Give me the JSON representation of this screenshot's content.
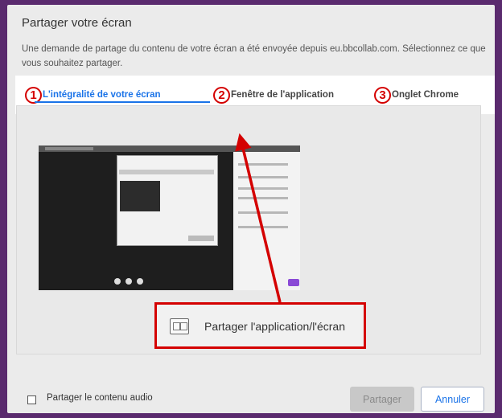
{
  "dialog": {
    "title": "Partager votre écran",
    "description": "Une demande de partage du contenu de votre écran a été envoyée depuis eu.bbcollab.com. Sélectionnez ce que vous souhaitez partager."
  },
  "tabs": [
    {
      "number": "1",
      "label": "L'intégralité de votre écran",
      "active": true
    },
    {
      "number": "2",
      "label": "Fenêtre de l'application",
      "active": false
    },
    {
      "number": "3",
      "label": "Onglet Chrome",
      "active": false
    }
  ],
  "callout": {
    "label": "Partager l'application/l'écran",
    "icon": "window-share-icon"
  },
  "footer": {
    "audio_label": "Partager le contenu audio",
    "share_button": "Partager",
    "cancel_button": "Annuler"
  },
  "colors": {
    "accent": "#1a73e8",
    "annotation_red": "#d40000",
    "backdrop": "#5a2a6e"
  }
}
